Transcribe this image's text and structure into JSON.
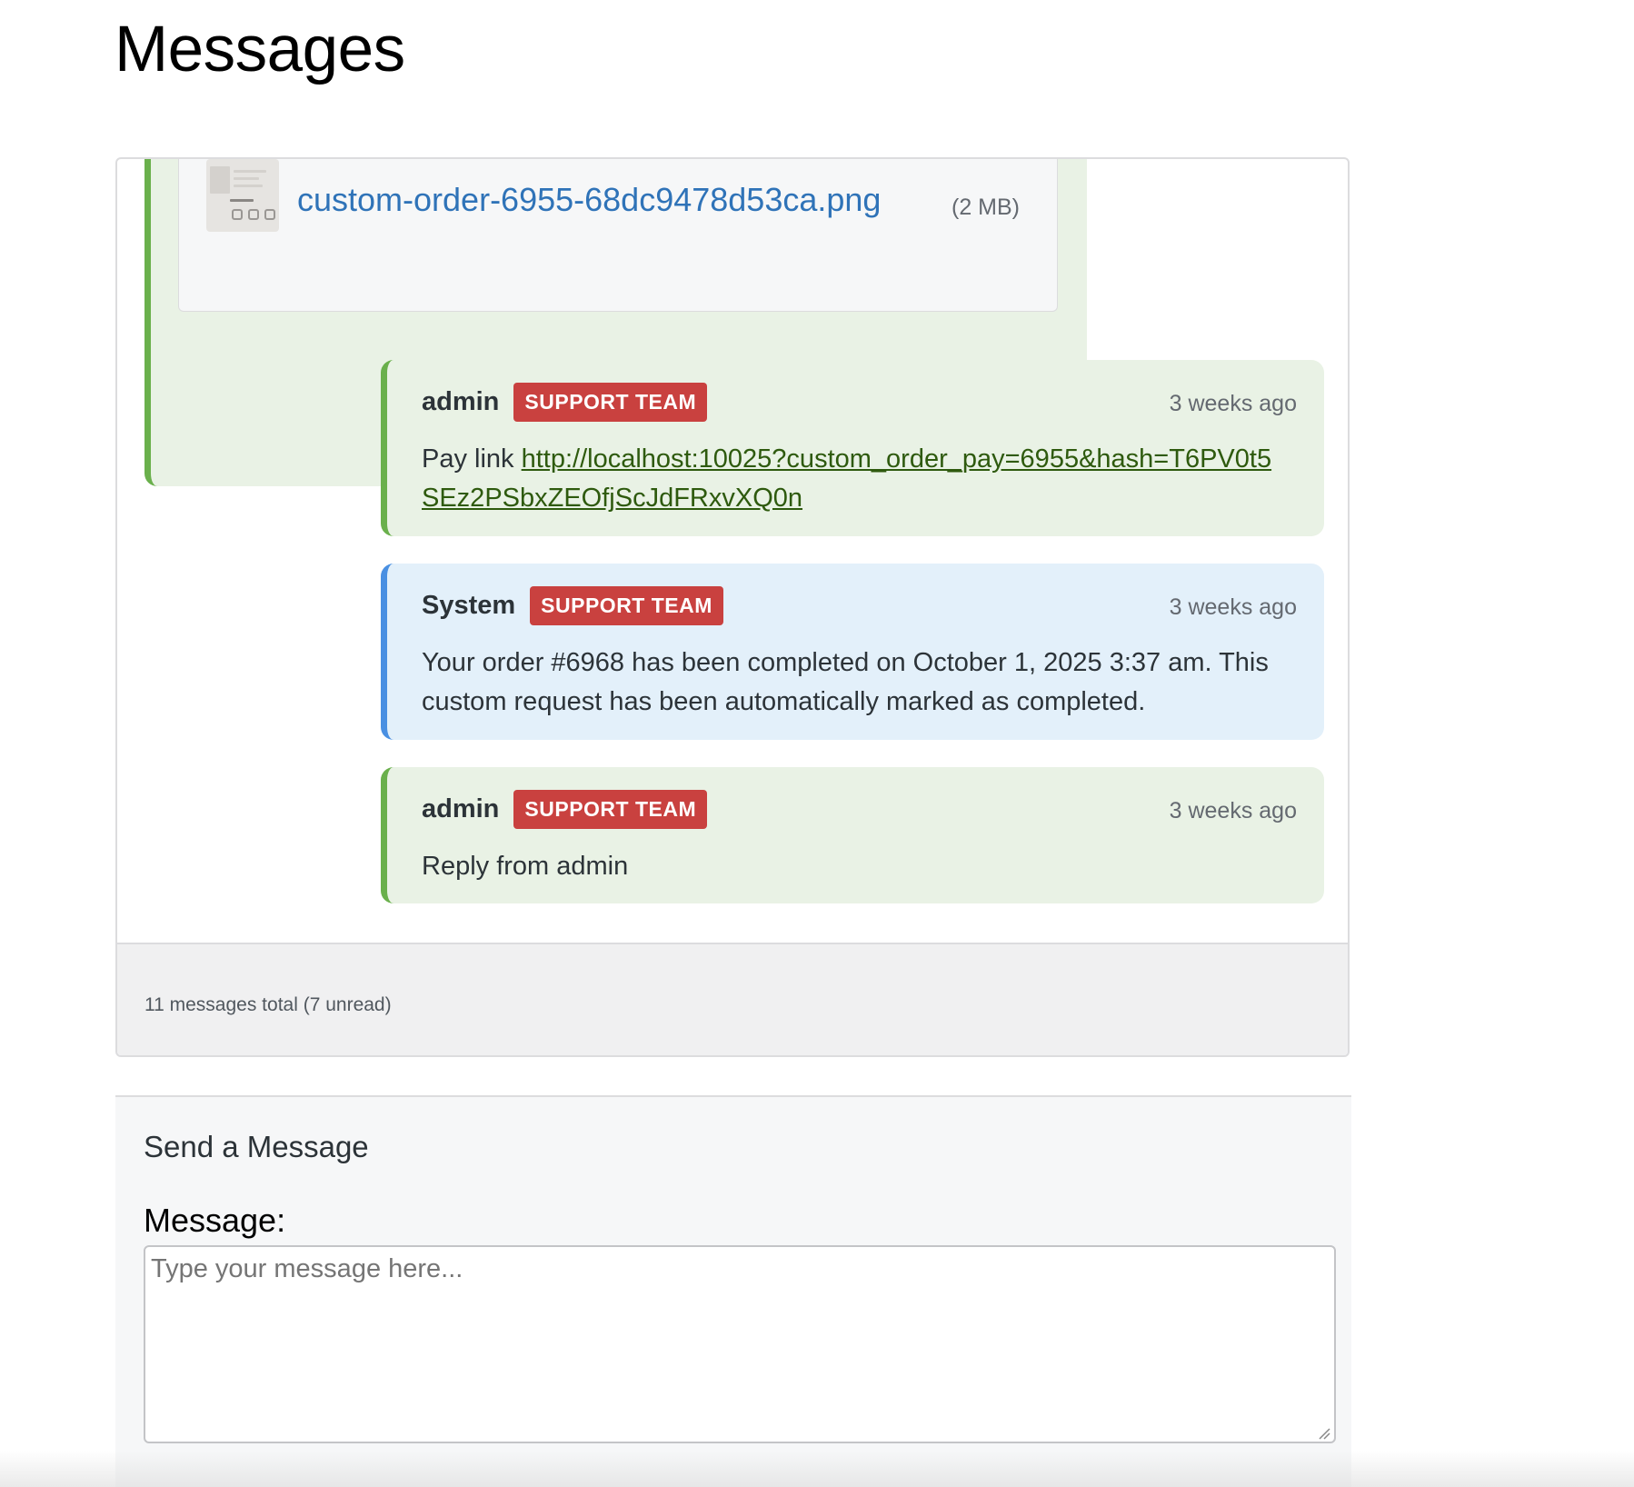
{
  "page": {
    "title": "Messages"
  },
  "attachment": {
    "filename": "custom-order-6955-68dc9478d53ca.png",
    "size": "(2 MB)"
  },
  "messages": [
    {
      "author": "admin",
      "badge": "SUPPORT TEAM",
      "time": "3 weeks ago",
      "body_prefix": "Pay link ",
      "link": "http://localhost:10025?custom_order_pay=6955&hash=T6PV0t5SEz2PSbxZEOfjScJdFRxvXQ0n",
      "style": "green"
    },
    {
      "author": "System",
      "badge": "SUPPORT TEAM",
      "time": "3 weeks ago",
      "body": "Your order #6968 has been completed on October 1, 2025 3:37 am. This custom request has been automatically marked as completed.",
      "style": "blue"
    },
    {
      "author": "admin",
      "badge": "SUPPORT TEAM",
      "time": "3 weeks ago",
      "body": "Reply from admin",
      "style": "green"
    }
  ],
  "footer": {
    "summary": "11 messages total (7 unread)"
  },
  "send": {
    "title": "Send a Message",
    "label": "Message:",
    "placeholder": "Type your message here..."
  },
  "colors": {
    "green_accent": "#6ab04c",
    "blue_accent": "#4a90e2",
    "badge": "#c9413f",
    "link": "#2f73b8"
  }
}
